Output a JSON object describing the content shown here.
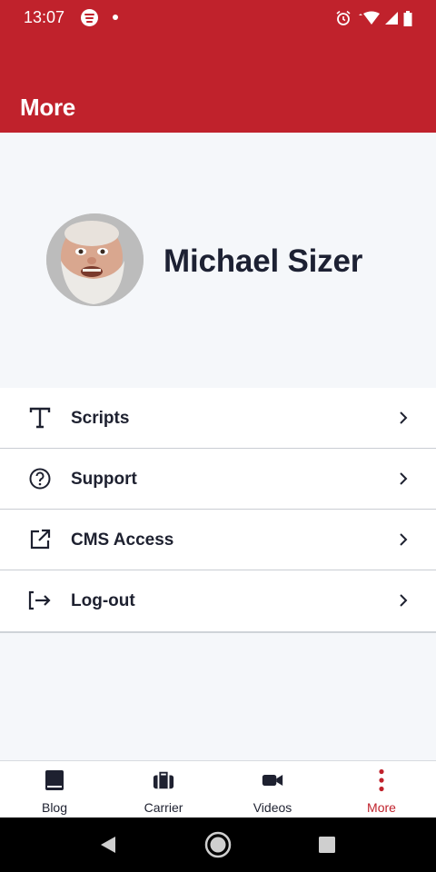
{
  "status_bar": {
    "time": "13:07",
    "icons": [
      "spotify-icon",
      "notification-dot-icon",
      "alarm-icon",
      "wifi-icon",
      "cell-signal-icon",
      "battery-icon"
    ]
  },
  "app_bar": {
    "title": "More"
  },
  "profile": {
    "name": "Michael Sizer",
    "avatar": "avatar"
  },
  "menu": {
    "items": [
      {
        "label": "Scripts",
        "icon": "text-icon"
      },
      {
        "label": "Support",
        "icon": "help-circle-icon"
      },
      {
        "label": "CMS Access",
        "icon": "external-link-icon"
      },
      {
        "label": "Log-out",
        "icon": "logout-icon"
      }
    ]
  },
  "tabs": [
    {
      "label": "Blog",
      "icon": "book-icon"
    },
    {
      "label": "Carrier",
      "icon": "briefcase-icon"
    },
    {
      "label": "Videos",
      "icon": "video-camera-icon"
    },
    {
      "label": "More",
      "icon": "more-vertical-icon",
      "active": true
    }
  ],
  "colors": {
    "brand_red": "#c0222c",
    "text_dark": "#1e2130",
    "background": "#f5f7fa"
  }
}
